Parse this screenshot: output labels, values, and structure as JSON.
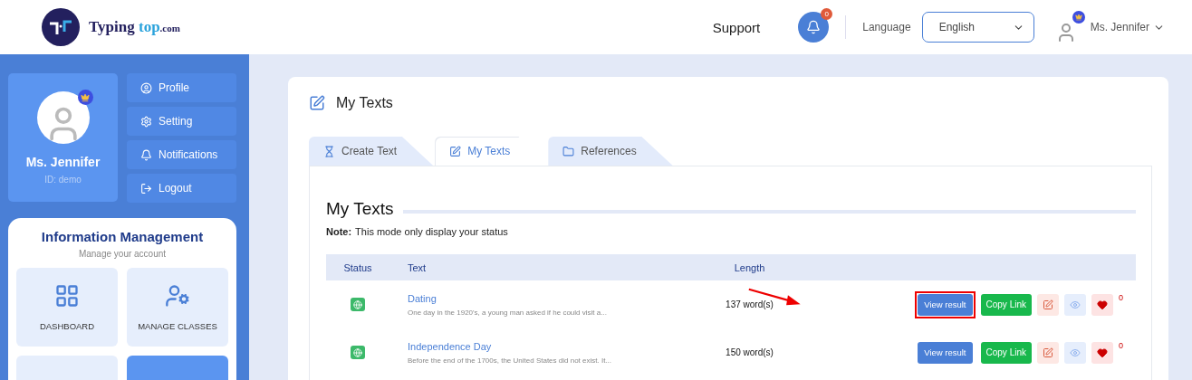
{
  "header": {
    "logo": {
      "word": "Typing",
      "accent": "top",
      "suffix": ".com"
    },
    "support": "Support",
    "notifications": {
      "count": "0"
    },
    "language": {
      "label": "Language",
      "value": "English"
    },
    "user": {
      "name": "Ms. Jennifer"
    }
  },
  "sidebar": {
    "profile": {
      "name": "Ms. Jennifer",
      "id": "ID: demo"
    },
    "menu": [
      {
        "label": "Profile"
      },
      {
        "label": "Setting"
      },
      {
        "label": "Notifications"
      },
      {
        "label": "Logout"
      }
    ],
    "info": {
      "title": "Information Management",
      "subtitle": "Manage your account",
      "tiles": [
        {
          "label": "DASHBOARD",
          "selected": false
        },
        {
          "label": "MANAGE CLASSES",
          "selected": false
        },
        {
          "selected": false
        },
        {
          "selected": true
        }
      ]
    }
  },
  "main": {
    "title": "My Texts",
    "tabs": [
      {
        "label": "Create Text",
        "selected": false
      },
      {
        "label": "My Texts",
        "selected": true
      },
      {
        "label": "References",
        "selected": false
      }
    ],
    "heading": "My Texts",
    "note": {
      "label": "Note:",
      "text": "This mode only display your status"
    },
    "columns": [
      "Status",
      "Text",
      "Length"
    ],
    "rows": [
      {
        "title": "Dating",
        "excerpt": "One day in the 1920's, a young man asked if he could visit a...",
        "length": "137 word(s)",
        "view": "View result",
        "copy": "Copy Link",
        "likes": "0",
        "highlighted": true
      },
      {
        "title": "Independence Day",
        "excerpt": "Before the end of the 1700s, the United States did not exist. It...",
        "length": "150 word(s)",
        "view": "View result",
        "copy": "Copy Link",
        "likes": "0",
        "highlighted": false
      }
    ]
  }
}
